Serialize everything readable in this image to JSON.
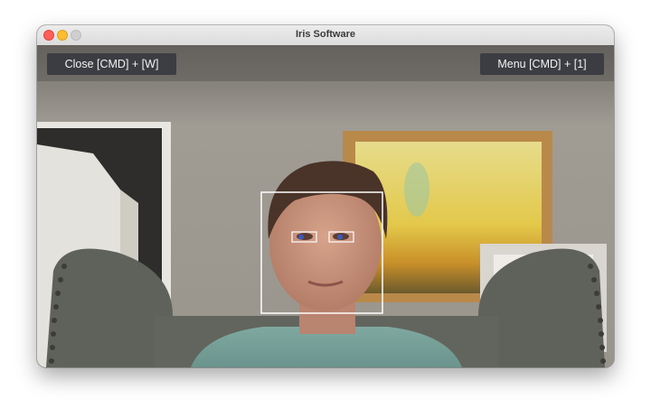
{
  "window": {
    "title": "Iris Software"
  },
  "toolbar": {
    "close_label": "Close [CMD] + [W]",
    "menu_label": "Menu [CMD] + [1]"
  },
  "overlay": {
    "face_box_color": "#ffffff",
    "eye_box_color": "#ffffff",
    "detected_pupil_color": "#3f57b8"
  },
  "colors": {
    "traffic_close": "#ff5f57",
    "traffic_minimize": "#febc2e",
    "traffic_zoom_inactive": "#cfcfcf",
    "button_bg": "#3b3d42"
  }
}
